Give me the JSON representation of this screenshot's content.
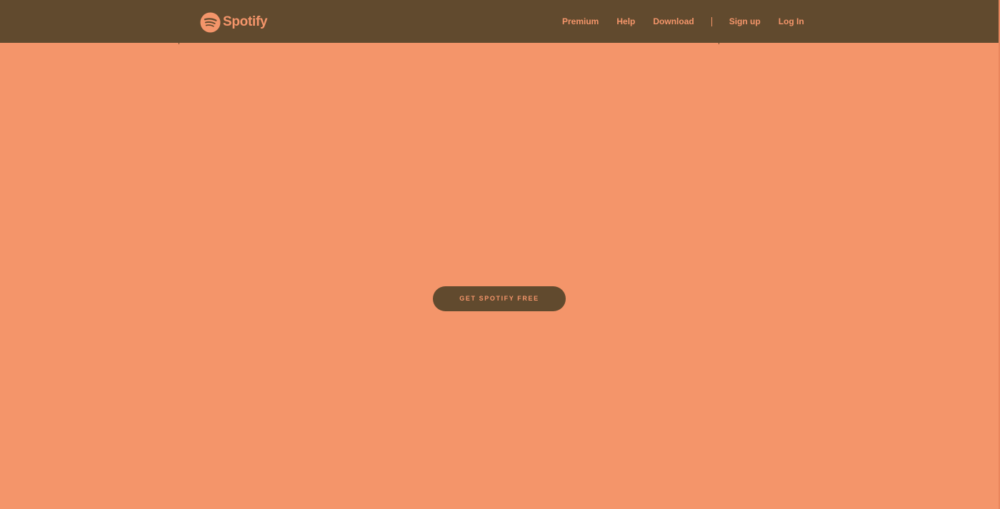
{
  "colors": {
    "page_background": "#f4956a",
    "header_background": "#614a2e",
    "accent": "#f4956a",
    "button_background": "#614a2e"
  },
  "header": {
    "logo": {
      "icon": "spotify-logo-icon",
      "wordmark": "Spotify"
    },
    "nav": {
      "premium": "Premium",
      "help": "Help",
      "download": "Download",
      "sign_up": "Sign up",
      "log_in": "Log In"
    }
  },
  "main": {
    "cta_label": "GET SPOTIFY FREE"
  }
}
